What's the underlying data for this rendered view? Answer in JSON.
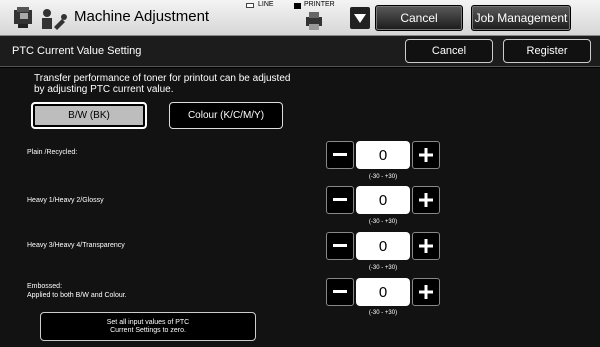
{
  "header": {
    "title": "Machine Adjustment",
    "line_status": "LINE",
    "printer_status": "PRINTER",
    "cancel_label": "Cancel",
    "job_management_label": "Job Management"
  },
  "subheader": {
    "title": "PTC Current Value Setting",
    "cancel_label": "Cancel",
    "register_label": "Register"
  },
  "description": {
    "line1": "Transfer performance of toner for printout can be adjusted",
    "line2": "by adjusting PTC current value."
  },
  "color_tabs": {
    "bw_label": "B/W (BK)",
    "colour_label": "Colour (K/C/M/Y)",
    "selected": "bw"
  },
  "settings": [
    {
      "label": "Plain /Recycled:",
      "value": "0",
      "range": "(-30 - +30)"
    },
    {
      "label": "Heavy 1/Heavy 2/Glossy",
      "value": "0",
      "range": "(-30 - +30)"
    },
    {
      "label": "Heavy 3/Heavy 4/Transparency",
      "value": "0",
      "range": "(-30 - +30)"
    },
    {
      "label": "Embossed:",
      "sublabel": "Applied to both B/W and Colour.",
      "value": "0",
      "range": "(-30 - +30)"
    }
  ],
  "reset": {
    "line1": "Set all input values of PTC",
    "line2": "Current Settings to zero."
  },
  "icons": {
    "mode": "machine-adjustment-icon",
    "dropdown": "triangle-down-icon",
    "printer": "printer-status-icon"
  }
}
